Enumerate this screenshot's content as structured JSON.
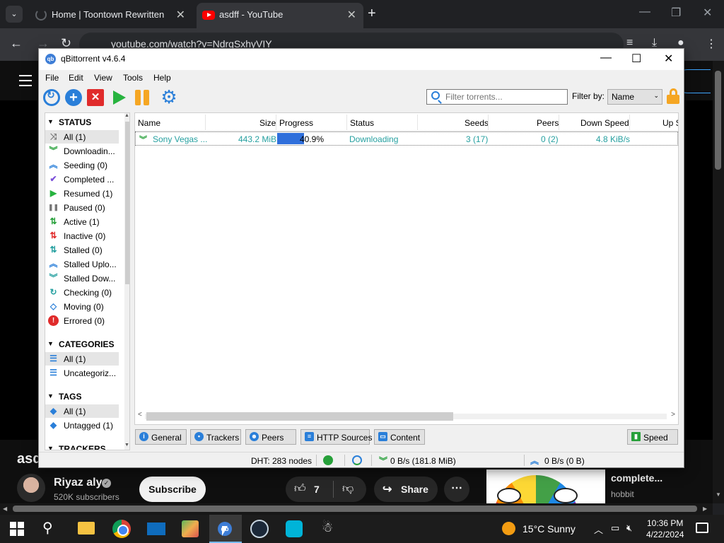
{
  "browser": {
    "tabs": [
      {
        "title": "Home | Toontown Rewritten",
        "active": false
      },
      {
        "title": "asdff - YouTube",
        "active": true
      }
    ],
    "url": "youtube.com/watch?v=NdrqSxhyVIY"
  },
  "youtube": {
    "video_title": "asd",
    "channel": "Riyaz aly",
    "subscribers": "520K subscribers",
    "subscribe_label": "Subscribe",
    "likes": "7",
    "share_label": "Share",
    "recommended": {
      "title": "complete...",
      "channel": "hobbit"
    }
  },
  "qbt": {
    "window_title": "qBittorrent v4.6.4",
    "menu": [
      "File",
      "Edit",
      "View",
      "Tools",
      "Help"
    ],
    "filter_placeholder": "Filter torrents...",
    "filter_by_label": "Filter by:",
    "filter_by_value": "Name",
    "sidebar": {
      "status_header": "STATUS",
      "status_items": [
        {
          "label": "All (1)",
          "icon": "shuffle-icon",
          "color": "#777777"
        },
        {
          "label": "Downloadin...",
          "icon": "double-chevron-down-icon",
          "color": "#27a03a"
        },
        {
          "label": "Seeding (0)",
          "icon": "double-chevron-up-icon",
          "color": "#2a7fd9"
        },
        {
          "label": "Completed ...",
          "icon": "checkmark-icon",
          "color": "#7b4fd9"
        },
        {
          "label": "Resumed (1)",
          "icon": "play-icon",
          "color": "#27b33f"
        },
        {
          "label": "Paused (0)",
          "icon": "pause-icon",
          "color": "#777777"
        },
        {
          "label": "Active (1)",
          "icon": "arrows-updown-icon",
          "color": "#27a03a"
        },
        {
          "label": "Inactive (0)",
          "icon": "arrows-updown-icon",
          "color": "#e02b2b"
        },
        {
          "label": "Stalled (0)",
          "icon": "arrows-updown-icon",
          "color": "#26a0a0"
        },
        {
          "label": "Stalled Uplo...",
          "icon": "double-chevron-up-icon",
          "color": "#2a7fd9"
        },
        {
          "label": "Stalled Dow...",
          "icon": "double-chevron-down-icon",
          "color": "#26a0a0"
        },
        {
          "label": "Checking (0)",
          "icon": "refresh-icon",
          "color": "#26a0a0"
        },
        {
          "label": "Moving (0)",
          "icon": "move-icon",
          "color": "#2a7fd9"
        },
        {
          "label": "Errored (0)",
          "icon": "error-icon",
          "color": "#e02b2b"
        }
      ],
      "categories_header": "CATEGORIES",
      "category_items": [
        {
          "label": "All (1)",
          "icon": "list-icon"
        },
        {
          "label": "Uncategoriz...",
          "icon": "list-icon"
        }
      ],
      "tags_header": "TAGS",
      "tag_items": [
        {
          "label": "All (1)",
          "icon": "tag-icon"
        },
        {
          "label": "Untagged (1)",
          "icon": "tag-icon"
        }
      ],
      "trackers_header": "TRACKERS"
    },
    "columns": [
      "Name",
      "Size",
      "Progress",
      "Status",
      "Seeds",
      "Peers",
      "Down Speed",
      "Up S"
    ],
    "torrent": {
      "name": "Sony Vegas ...",
      "size": "443.2 MiB",
      "progress_label": "40.9%",
      "progress": 0.409,
      "status": "Downloading",
      "seeds": "3 (17)",
      "peers": "0 (2)",
      "down_speed": "4.8 KiB/s"
    },
    "prop_tabs": [
      "General",
      "Trackers",
      "Peers",
      "HTTP Sources",
      "Content"
    ],
    "speed_tab": "Speed",
    "statusbar": {
      "dht": "DHT: 283 nodes",
      "down": "0 B/s (181.8 MiB)",
      "up": "0 B/s (0 B)"
    }
  },
  "taskbar": {
    "weather": "15°C  Sunny",
    "time": "10:36 PM",
    "date": "4/22/2024"
  },
  "colors": {
    "accent": "#2a7fd9",
    "green": "#27a03a",
    "teal_text": "#26a0a0"
  }
}
